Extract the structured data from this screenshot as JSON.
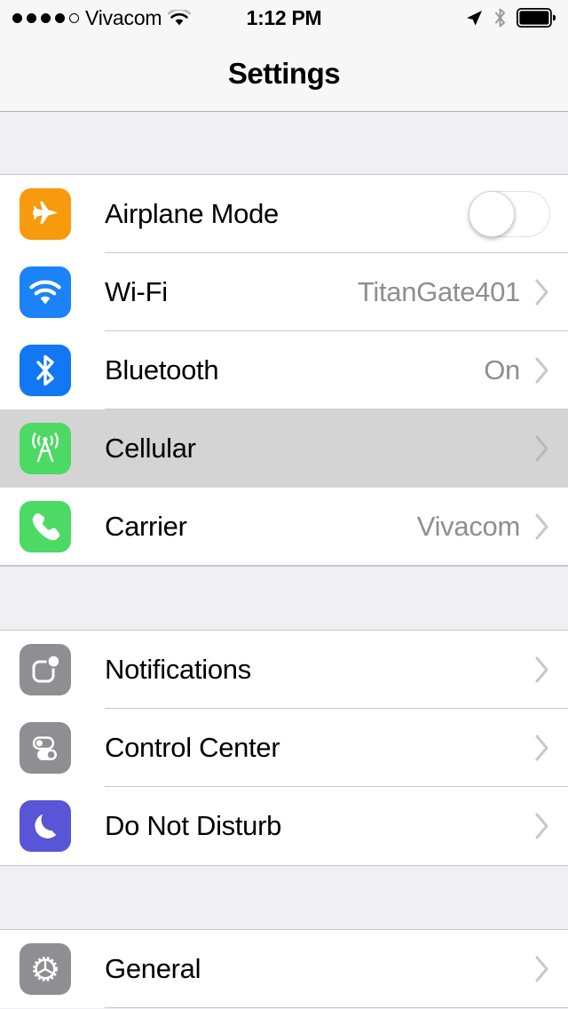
{
  "status_bar": {
    "signal_dots_filled": 4,
    "signal_dots_total": 5,
    "carrier": "Vivacom",
    "wifi_icon": "wifi-icon",
    "time": "1:12 PM",
    "location_icon": "location-arrow-icon",
    "bluetooth_icon": "bluetooth-icon",
    "battery_icon": "battery-full-icon"
  },
  "navbar": {
    "title": "Settings"
  },
  "colors": {
    "airplane": "#f89a0e",
    "wifi": "#1b82f7",
    "bluetooth": "#1277f2",
    "cellular": "#4cd964",
    "carrier": "#4cd964",
    "notifications": "#8e8e93",
    "control_center": "#8e8e93",
    "do_not_disturb": "#5856d6",
    "general": "#8e8e93",
    "value_text": "#8e8e93",
    "chevron": "#c7c7cc",
    "group_background": "#efeff4",
    "row_pressed": "#d4d4d4"
  },
  "groups": [
    {
      "rows": [
        {
          "label": "Airplane Mode",
          "icon": "airplane-icon",
          "accessory": "toggle",
          "toggle_on": false,
          "value": ""
        },
        {
          "label": "Wi-Fi",
          "icon": "wifi-icon",
          "accessory": "chevron",
          "value": "TitanGate401"
        },
        {
          "label": "Bluetooth",
          "icon": "bluetooth-icon",
          "accessory": "chevron",
          "value": "On"
        },
        {
          "label": "Cellular",
          "icon": "cellular-antenna-icon",
          "accessory": "chevron",
          "value": "",
          "pressed": true
        },
        {
          "label": "Carrier",
          "icon": "phone-handset-icon",
          "accessory": "chevron",
          "value": "Vivacom"
        }
      ]
    },
    {
      "rows": [
        {
          "label": "Notifications",
          "icon": "notifications-badge-icon",
          "accessory": "chevron",
          "value": ""
        },
        {
          "label": "Control Center",
          "icon": "control-center-switches-icon",
          "accessory": "chevron",
          "value": ""
        },
        {
          "label": "Do Not Disturb",
          "icon": "crescent-moon-icon",
          "accessory": "chevron",
          "value": ""
        }
      ]
    },
    {
      "rows": [
        {
          "label": "General",
          "icon": "gear-icon",
          "accessory": "chevron",
          "value": ""
        }
      ]
    }
  ]
}
